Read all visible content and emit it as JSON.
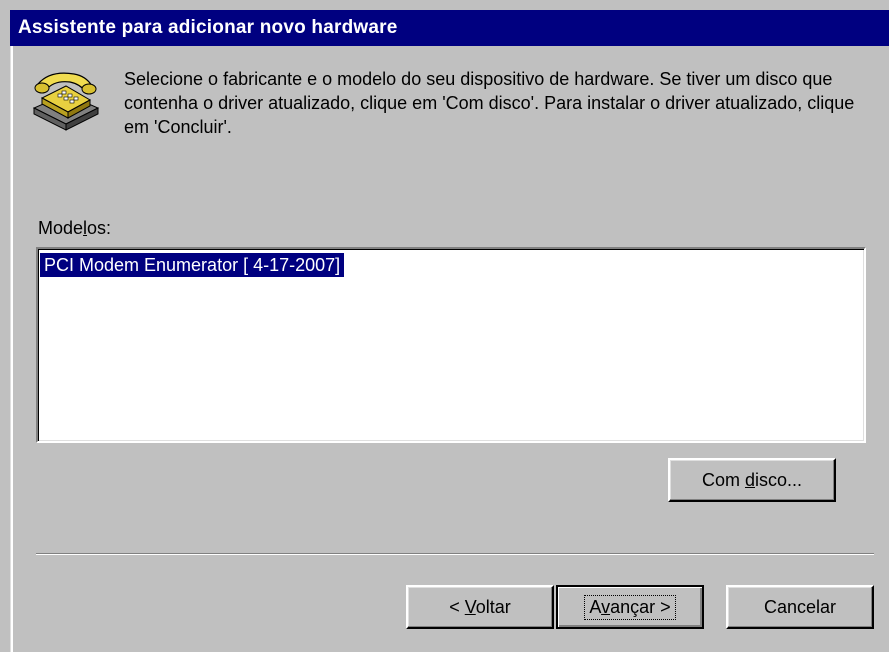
{
  "window": {
    "title": "Assistente para adicionar novo hardware"
  },
  "icon": {
    "name": "telephone-modem-icon"
  },
  "description": "Selecione o fabricante e o modelo do seu dispositivo de hardware. Se tiver um disco que contenha o driver atualizado, clique em 'Com disco'. Para instalar o driver atualizado, clique em 'Concluir'.",
  "models": {
    "label_pre": "Mode",
    "label_accel": "l",
    "label_post": "os:",
    "items": [
      "PCI Modem Enumerator [ 4-17-2007]"
    ],
    "selected_index": 0
  },
  "buttons": {
    "have_disk_pre": "Com ",
    "have_disk_accel": "d",
    "have_disk_post": "isco...",
    "back_pre": "< ",
    "back_accel": "V",
    "back_post": "oltar",
    "next_pre": "A",
    "next_accel": "v",
    "next_post": "ançar >",
    "cancel": "Cancelar"
  },
  "colors": {
    "titlebar": "#000080",
    "face": "#c0c0c0",
    "selection": "#000080"
  }
}
